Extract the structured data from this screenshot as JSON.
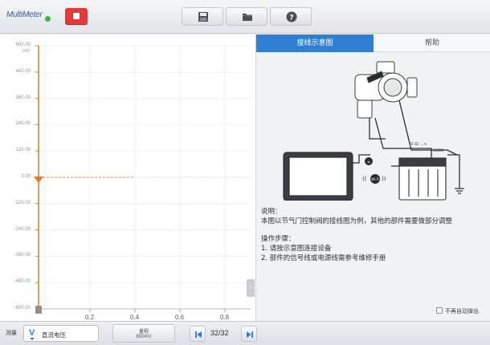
{
  "app": {
    "title": "MultiMeter",
    "accent_color": "#2f7fd4",
    "stop_color": "#e23a3a"
  },
  "toolbar": {
    "stop_icon": "stop-square-icon",
    "buttons": [
      {
        "name": "save-data",
        "icon": "save-icon"
      },
      {
        "name": "open-file",
        "icon": "folder-icon"
      },
      {
        "name": "help",
        "icon": "help-icon"
      }
    ]
  },
  "graph": {
    "unit": "mV",
    "y_ticks": [
      "600.00",
      "480.00",
      "360.00",
      "240.00",
      "120.00",
      "0.00",
      "-120.00",
      "-240.00",
      "-360.00",
      "-480.00",
      "-600.00"
    ],
    "x_ticks": [
      "0.2",
      "0.4",
      "0.6",
      "0.8"
    ],
    "trace_color": "#f0a060",
    "axis_color": "#e07b2a"
  },
  "panel": {
    "tabs": [
      "接线示意图",
      "帮助"
    ],
    "diagram_labels": {
      "vo": "V·Ω·→+",
      "com": "COM"
    },
    "description_title": "说明：",
    "description_text": "本图以节气门控制阀的接线图为例，其他的部件需要做部分调整",
    "steps_title": "操作步骤：",
    "steps": [
      "1. 请按示意图连接设备",
      "2. 部件的信号线或电源线需参考维修手册"
    ],
    "auto_popup_label": "不再自动弹出"
  },
  "bottom": {
    "measure_label": "测量",
    "measure_value": "直流电压",
    "range_label": "量程",
    "range_value": "600mV",
    "page_indicator": "32/32"
  }
}
